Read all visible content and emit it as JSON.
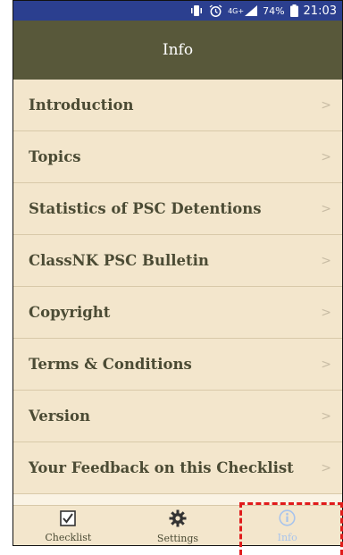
{
  "status_bar": {
    "network": "4G+",
    "battery": "74%",
    "time": "21:03",
    "icons": [
      "vibrate-icon",
      "alarm-icon",
      "signal-icon",
      "battery-icon"
    ]
  },
  "app_bar": {
    "title": "Info"
  },
  "menu": {
    "chevron": ">",
    "items": [
      {
        "label": "Introduction"
      },
      {
        "label": "Topics"
      },
      {
        "label": "Statistics of PSC Detentions"
      },
      {
        "label": "ClassNK PSC Bulletin"
      },
      {
        "label": "Copyright"
      },
      {
        "label": "Terms & Conditions"
      },
      {
        "label": "Version"
      },
      {
        "label": "Your Feedback on this Checklist"
      }
    ]
  },
  "bottom_nav": {
    "tabs": [
      {
        "label": "Checklist",
        "icon": "checkbox-icon"
      },
      {
        "label": "Settings",
        "icon": "gear-icon"
      },
      {
        "label": "Info",
        "icon": "info-icon",
        "active": true
      }
    ]
  },
  "colors": {
    "status_bar": "#2b3f8f",
    "app_bar": "#58583a",
    "background": "#f3e6cc",
    "text": "#4b4b34",
    "active_tab": "#a8c4ec",
    "highlight": "#e01b1b"
  }
}
